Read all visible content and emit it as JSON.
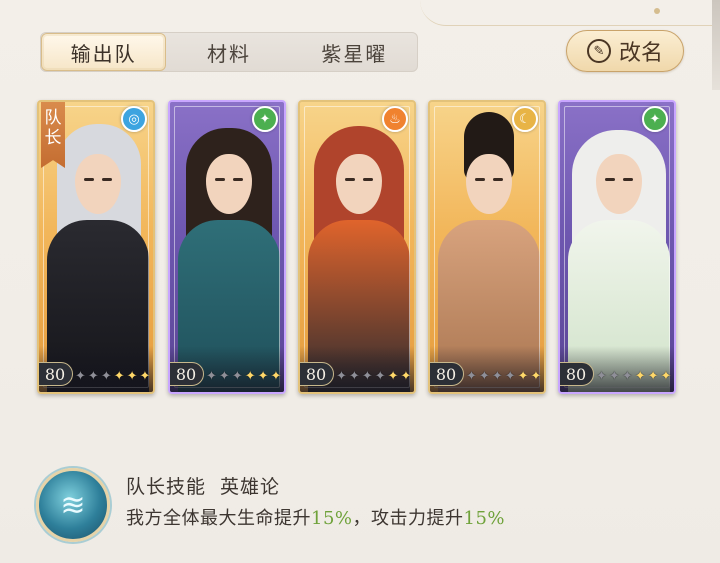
{
  "tabs": [
    {
      "label": "输出队",
      "active": true
    },
    {
      "label": "材料",
      "active": false
    },
    {
      "label": "紫星曜",
      "active": false
    }
  ],
  "rename": {
    "label": "改名",
    "icon": "brush-icon"
  },
  "cards": [
    {
      "theme": "gold",
      "level": "80",
      "leader_label": "队长",
      "element_icon": "water-swirl-icon",
      "element_glyph": "◎",
      "element_color": "#3da4e0",
      "stars_lit": 3,
      "stars_total": 6
    },
    {
      "theme": "purple",
      "level": "80",
      "element_icon": "leaf-icon",
      "element_glyph": "✦",
      "element_color": "#4caf50",
      "stars_lit": 3,
      "stars_total": 6
    },
    {
      "theme": "gold",
      "level": "80",
      "element_icon": "flame-icon",
      "element_glyph": "♨",
      "element_color": "#f0822f",
      "stars_lit": 2,
      "stars_total": 6
    },
    {
      "theme": "gold",
      "level": "80",
      "element_icon": "moon-icon",
      "element_glyph": "☾",
      "element_color": "#e8b446",
      "stars_lit": 2,
      "stars_total": 6
    },
    {
      "theme": "purple",
      "level": "80",
      "element_icon": "leaf-icon",
      "element_glyph": "✦",
      "element_color": "#4caf50",
      "stars_lit": 3,
      "stars_total": 6
    }
  ],
  "leader_skill": {
    "label": "队长技能",
    "name": "英雄论",
    "desc_part1": "我方全体最大生命提升",
    "value1": "15%",
    "desc_part2": "，攻击力提升",
    "value2": "15%",
    "icon": "fish-water-icon"
  }
}
